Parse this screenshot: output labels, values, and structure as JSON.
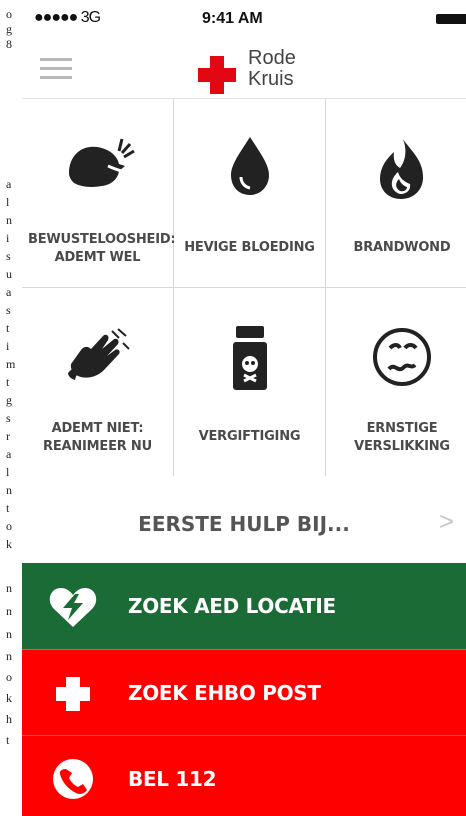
{
  "edge_text": [
    "o",
    "g",
    "8",
    "a",
    "l",
    "n",
    "i",
    "s",
    "u",
    "a",
    "s",
    "t",
    "i",
    "m",
    "t",
    "g",
    "s",
    "r",
    "a",
    "l",
    "n",
    "t",
    "o",
    "k",
    "n",
    "n",
    "n",
    "n",
    "o",
    "k",
    "h",
    "t"
  ],
  "status_bar": {
    "signal": "●●●●● 3G",
    "time": "9:41 AM"
  },
  "header": {
    "logo_line_1": "Rode",
    "logo_line_2": "Kruis"
  },
  "tiles": [
    {
      "line_1": "BEWUSTELOOSHEID:",
      "line_2": "ADEMT WEL",
      "icon": "unconscious-person-breathing-icon"
    },
    {
      "line_1": "HEVIGE BLOEDING",
      "line_2": "",
      "icon": "blood-drop-icon"
    },
    {
      "line_1": "BRANDWOND",
      "line_2": "",
      "icon": "flame-icon"
    },
    {
      "line_1": "ADEMT NIET:",
      "line_2": "REANIMEER NU",
      "icon": "cpr-hands-icon"
    },
    {
      "line_1": "VERGIFTIGING",
      "line_2": "",
      "icon": "poison-bottle-icon"
    },
    {
      "line_1": "ERNSTIGE",
      "line_2": "VERSLIKKING",
      "icon": "choking-face-icon"
    }
  ],
  "first_aid_link": {
    "label": "EERSTE HULP BIJ...",
    "chevron": ">"
  },
  "actions": [
    {
      "label": "ZOEK AED LOCATIE",
      "icon": "aed-heart-lightning-icon",
      "color": "#1a6b36"
    },
    {
      "label": "ZOEK EHBO POST",
      "icon": "first-aid-cross-icon",
      "color": "#ff0000"
    },
    {
      "label": "BEL 112",
      "icon": "phone-icon",
      "color": "#ff0000"
    }
  ]
}
